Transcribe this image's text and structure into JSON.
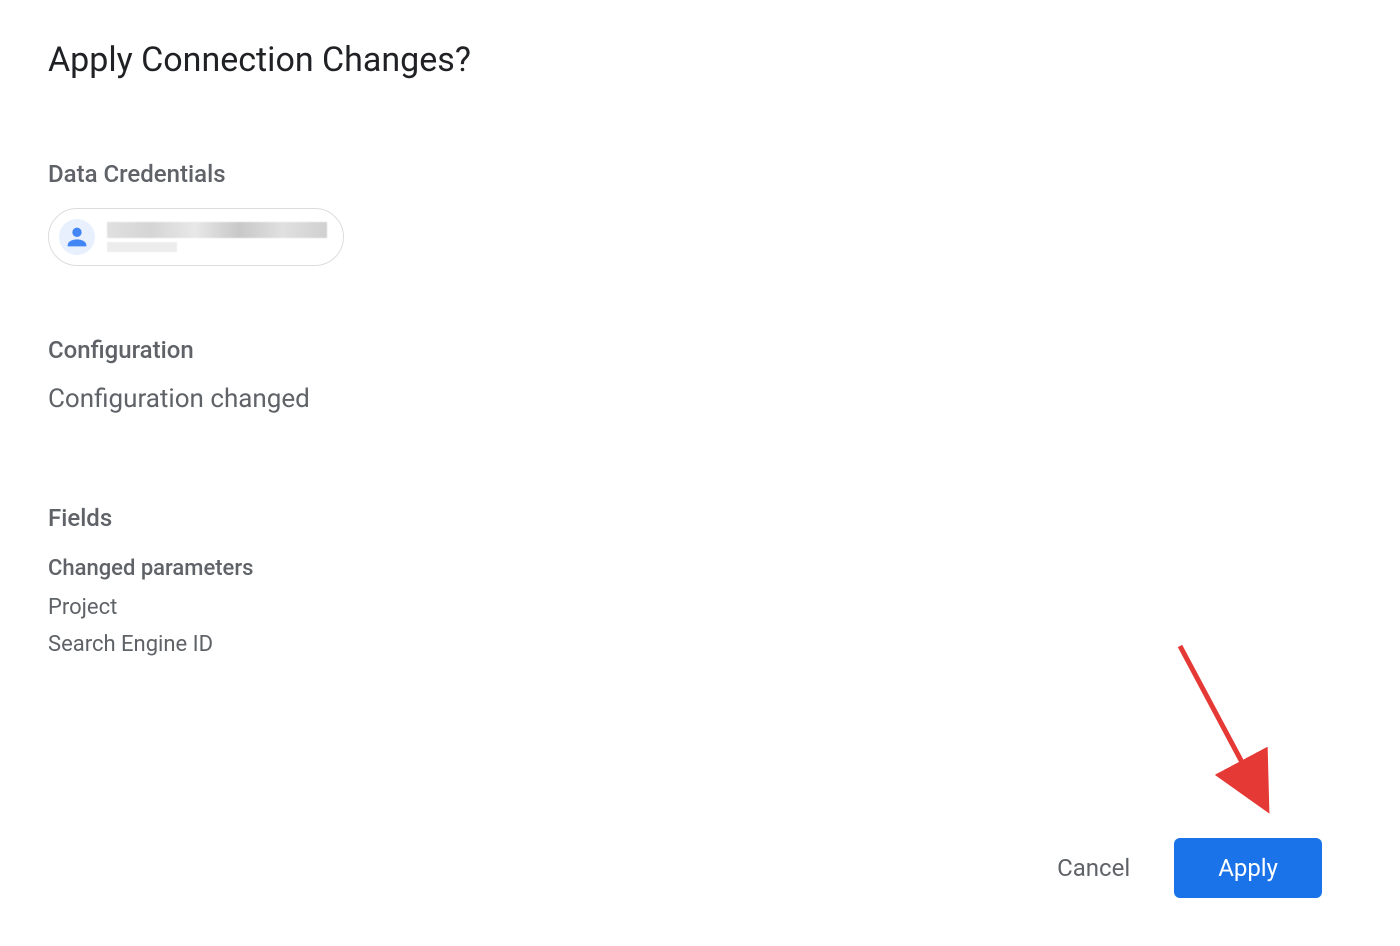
{
  "dialog": {
    "title": "Apply Connection Changes?"
  },
  "sections": {
    "credentials": {
      "heading": "Data Credentials"
    },
    "configuration": {
      "heading": "Configuration",
      "status": "Configuration changed"
    },
    "fields": {
      "heading": "Fields",
      "sub_heading": "Changed parameters",
      "items": [
        "Project",
        "Search Engine ID"
      ]
    }
  },
  "buttons": {
    "cancel": "Cancel",
    "apply": "Apply"
  },
  "colors": {
    "primary": "#1a73e8",
    "text_heading": "#5f6368",
    "text_title": "#202124"
  }
}
